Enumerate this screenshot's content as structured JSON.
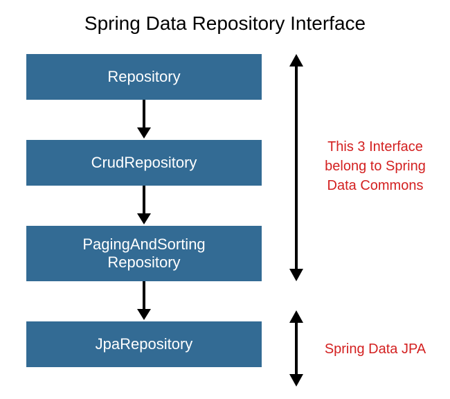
{
  "title": "Spring Data Repository Interface",
  "boxes": [
    {
      "label": "Repository"
    },
    {
      "label": "CrudRepository"
    },
    {
      "labelLine1": "PagingAndSorting",
      "labelLine2": "Repository"
    },
    {
      "label": "JpaRepository"
    }
  ],
  "annotations": [
    {
      "line1": "This 3 Interface",
      "line2": "belong to Spring",
      "line3": "Data Commons"
    },
    {
      "line1": "Spring Data JPA"
    }
  ],
  "colors": {
    "box_bg": "#336b94",
    "box_text": "#ffffff",
    "annotation_text": "#d32020"
  }
}
